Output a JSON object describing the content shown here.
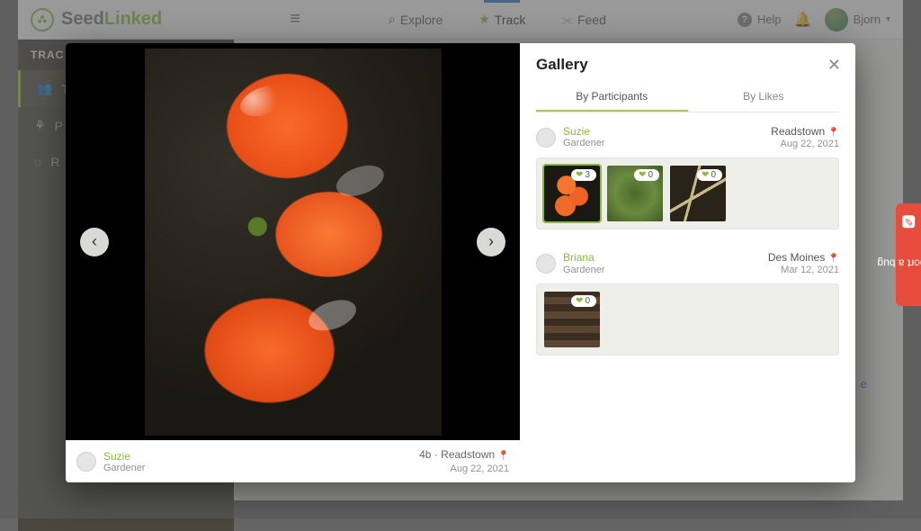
{
  "brand": {
    "part1": "Seed",
    "part2": "Linked"
  },
  "nav": {
    "explore": "Explore",
    "track": "Track",
    "feed": "Feed"
  },
  "top_right": {
    "help": "Help",
    "username": "Bjorn"
  },
  "subbar": {
    "title": "TRAC"
  },
  "sidebar": {
    "items": [
      {
        "icon": "👥",
        "label": "T"
      },
      {
        "icon": "⚘",
        "label": "P"
      },
      {
        "icon": "◌",
        "label": "R"
      }
    ]
  },
  "main": {
    "stray_letter": "o",
    "bottom_link_suffix": "e"
  },
  "modal": {
    "title": "Gallery",
    "tabs": {
      "participants": "By Participants",
      "likes": "By Likes"
    },
    "viewer": {
      "user": {
        "name": "Suzie",
        "role": "Gardener"
      },
      "meta_prefix": "4b",
      "location": "Readstown",
      "date": "Aug 22, 2021"
    },
    "growers": [
      {
        "name": "Suzie",
        "role": "Gardener",
        "city": "Readstown",
        "date": "Aug 22, 2021",
        "thumbs": [
          {
            "likes": 3,
            "kind": "tomato",
            "selected": true
          },
          {
            "likes": 0,
            "kind": "plant",
            "selected": false
          },
          {
            "likes": 0,
            "kind": "soil",
            "selected": false
          }
        ]
      },
      {
        "name": "Briana",
        "role": "Gardener",
        "city": "Des Moines",
        "date": "Mar 12, 2021",
        "thumbs": [
          {
            "likes": 0,
            "kind": "seedlings",
            "selected": false
          }
        ]
      }
    ]
  },
  "bug_tab": "Report a bug"
}
